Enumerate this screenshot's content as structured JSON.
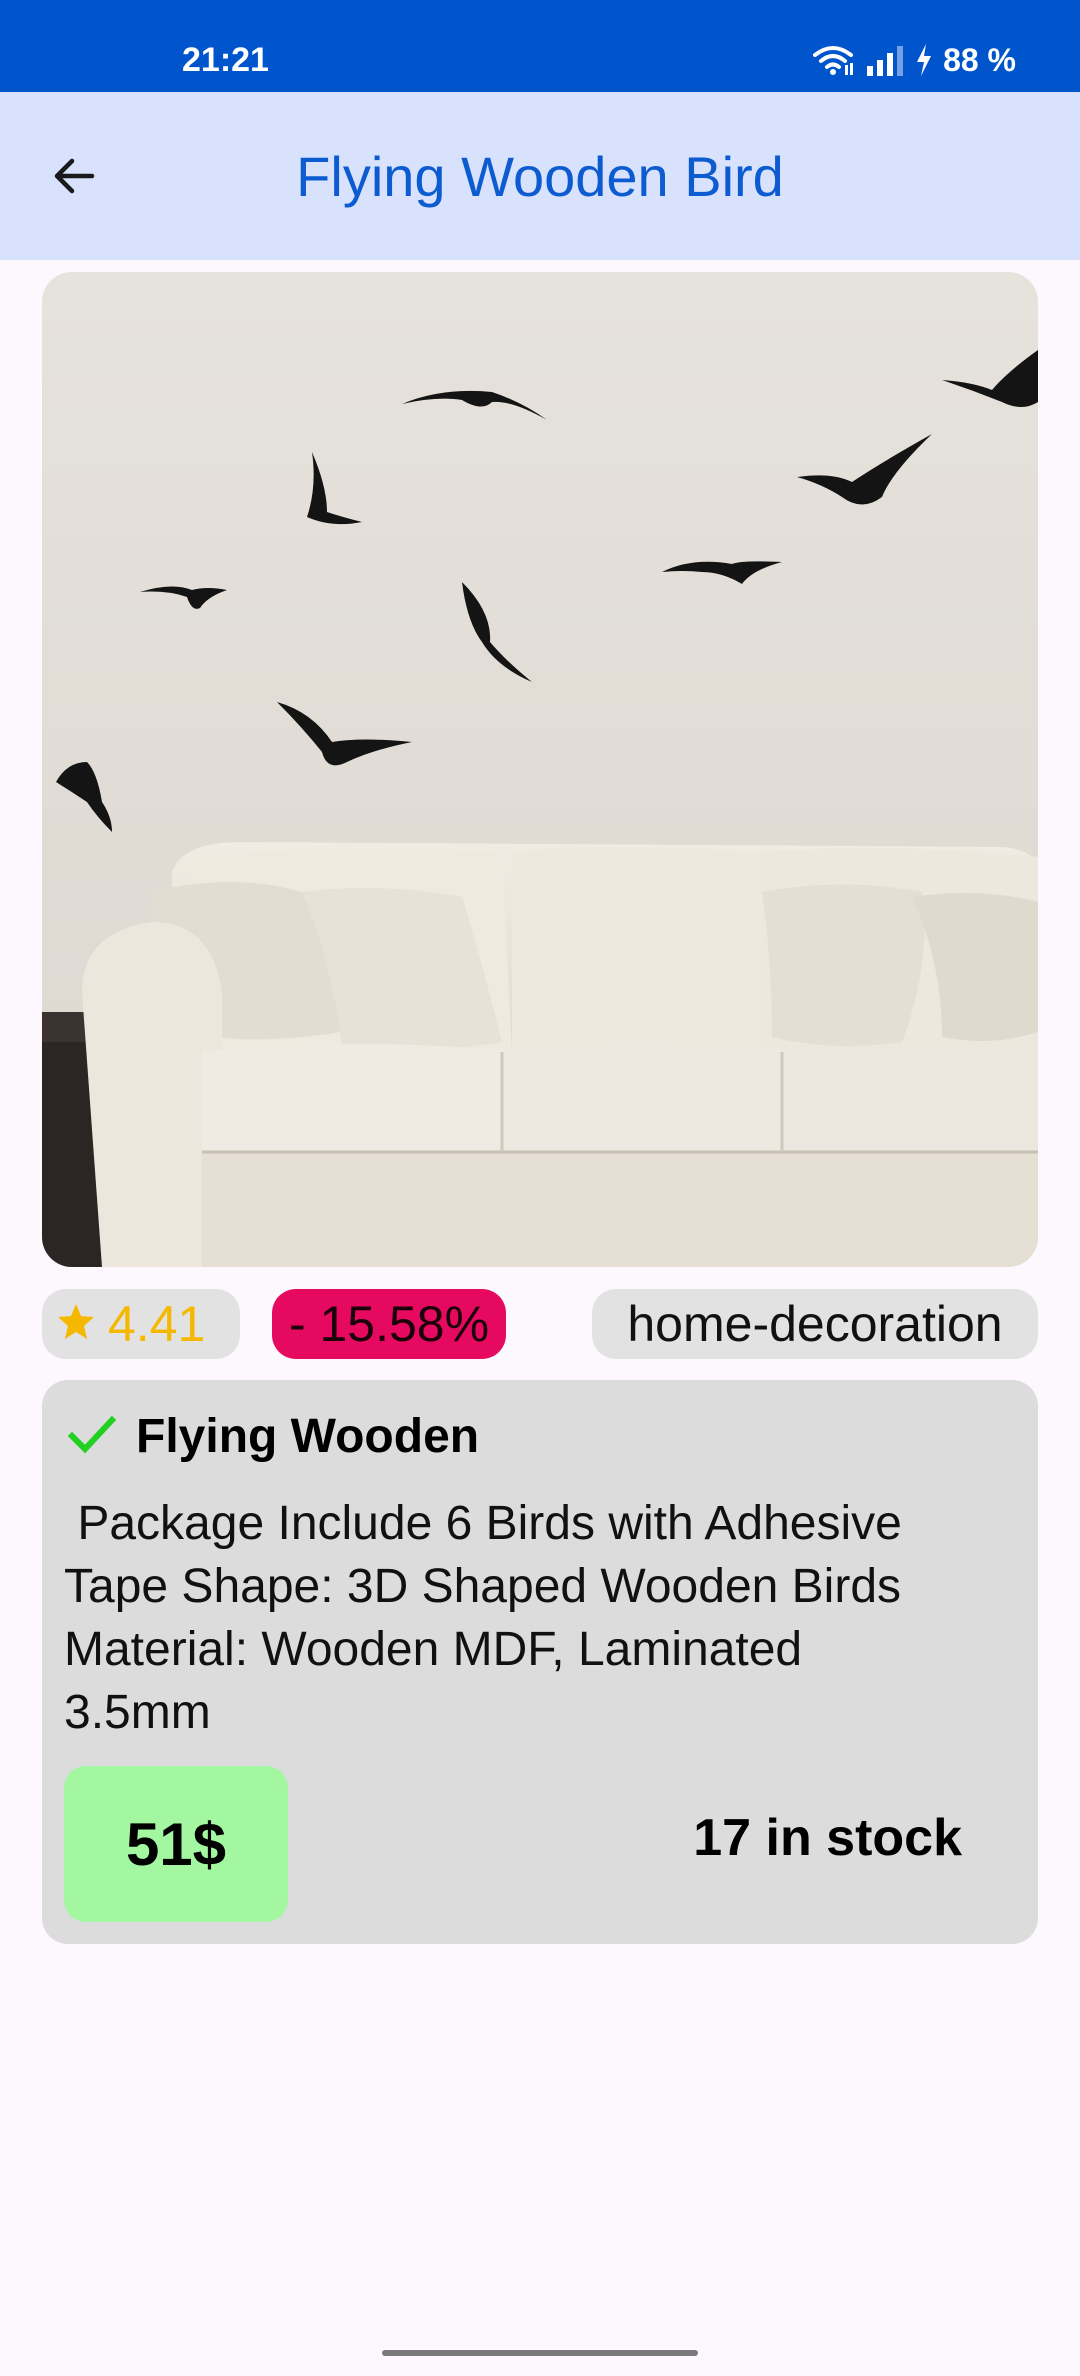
{
  "status_bar": {
    "time": "21:21",
    "battery": "88 %",
    "icons": [
      "wifi-icon",
      "signal-icon",
      "charging-icon"
    ]
  },
  "app_bar": {
    "title": "Flying Wooden Bird",
    "back_icon": "arrow-back-icon"
  },
  "product": {
    "image": "product-image-birds-over-sofa",
    "rating": "4.41",
    "rating_icon": "star-icon",
    "discount": "- 15.58%",
    "category": "home-decoration",
    "name": "Flying Wooden",
    "name_icon": "checkmark-icon",
    "description": " Package Include 6 Birds with Adhesive\nTape Shape: 3D Shaped Wooden Birds\nMaterial: Wooden MDF, Laminated\n3.5mm",
    "price": "51$",
    "stock": "17 in stock"
  },
  "colors": {
    "status_bar": "#0055cc",
    "app_bar": "#d8e2fc",
    "title": "#0d5bd0",
    "rating": "#f5b800",
    "discount_chip": "#e5095f",
    "price_badge": "#a2f7a0",
    "check": "#22d022"
  }
}
